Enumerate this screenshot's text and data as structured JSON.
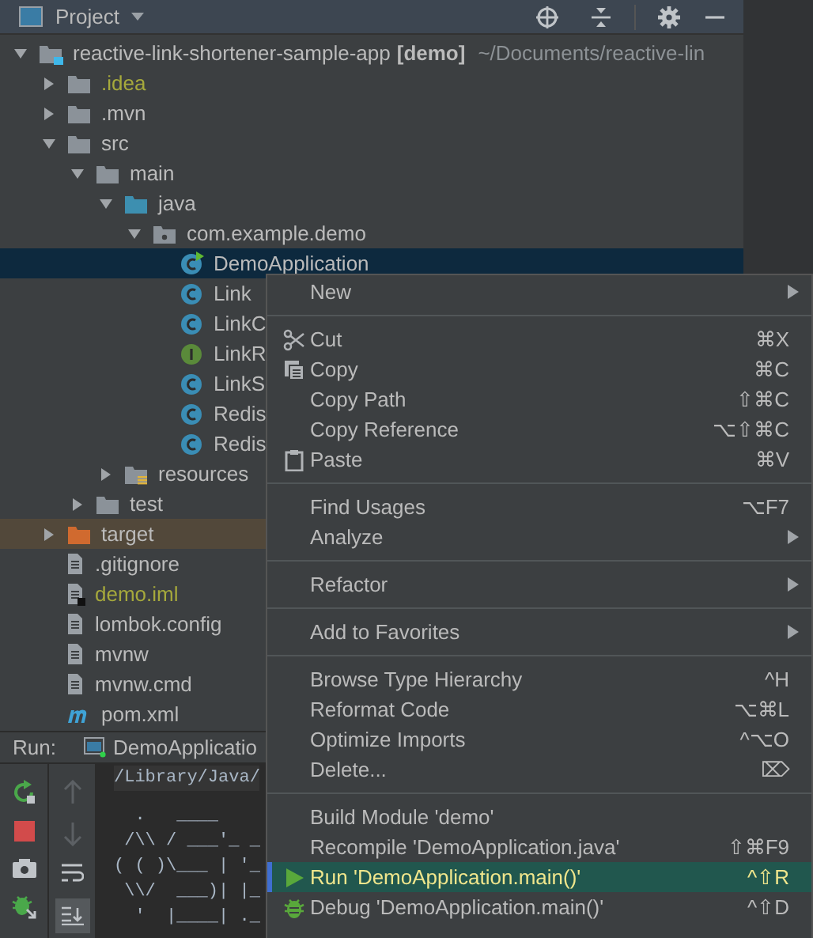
{
  "panel": {
    "title": "Project"
  },
  "tree": [
    {
      "label": "reactive-link-shortener-sample-app",
      "module": "[demo]",
      "path": "~/Documents/reactive-lin",
      "kind": "module",
      "expanded": true,
      "children": [
        {
          "label": ".idea",
          "kind": "folder",
          "expanded": false,
          "color": "#a6a93c"
        },
        {
          "label": ".mvn",
          "kind": "folder",
          "expanded": false
        },
        {
          "label": "src",
          "kind": "folder",
          "expanded": true,
          "children": [
            {
              "label": "main",
              "kind": "folder",
              "expanded": true,
              "children": [
                {
                  "label": "java",
                  "kind": "source",
                  "expanded": true,
                  "children": [
                    {
                      "label": "com.example.demo",
                      "kind": "package",
                      "expanded": true,
                      "children": [
                        {
                          "label": "DemoApplication",
                          "kind": "runclass",
                          "selected": true
                        },
                        {
                          "label": "Link",
                          "kind": "class",
                          "selected": false
                        },
                        {
                          "label": "LinkC",
                          "kind": "class",
                          "selected": false
                        },
                        {
                          "label": "LinkR",
                          "kind": "interface",
                          "selected": false
                        },
                        {
                          "label": "LinkS",
                          "kind": "class",
                          "selected": false
                        },
                        {
                          "label": "Redis",
                          "kind": "class",
                          "selected": false
                        },
                        {
                          "label": "Redis",
                          "kind": "class",
                          "selected": false
                        }
                      ]
                    }
                  ]
                },
                {
                  "label": "resources",
                  "kind": "resources",
                  "expanded": false
                }
              ]
            },
            {
              "label": "test",
              "kind": "folder",
              "expanded": false
            }
          ]
        },
        {
          "label": "target",
          "kind": "excluded",
          "expanded": false,
          "highlighted": true
        },
        {
          "label": ".gitignore",
          "kind": "file"
        },
        {
          "label": "demo.iml",
          "kind": "iml",
          "color": "#a6a93c"
        },
        {
          "label": "lombok.config",
          "kind": "file"
        },
        {
          "label": "mvnw",
          "kind": "file"
        },
        {
          "label": "mvnw.cmd",
          "kind": "file"
        },
        {
          "label": "pom.xml",
          "kind": "maven"
        }
      ]
    }
  ],
  "run": {
    "label": "Run:",
    "tab": "DemoApplicatio",
    "console": [
      "/Library/Java/",
      "  .   ____",
      " /\\\\ / ___'_ _",
      "( ( )\\___ | '_",
      " \\\\/  ___)| |_",
      "  '  |____| ._"
    ]
  },
  "menu": [
    {
      "kind": "item",
      "label": "New",
      "submenu": true
    },
    {
      "kind": "separator"
    },
    {
      "kind": "cut",
      "label": "Cut",
      "shortcut": "⌘X"
    },
    {
      "kind": "copy",
      "label": "Copy",
      "shortcut": "⌘C"
    },
    {
      "kind": "item",
      "label": "Copy Path",
      "shortcut": "⇧⌘C"
    },
    {
      "kind": "item",
      "label": "Copy Reference",
      "shortcut": "⌥⇧⌘C"
    },
    {
      "kind": "paste",
      "label": "Paste",
      "shortcut": "⌘V"
    },
    {
      "kind": "separator"
    },
    {
      "kind": "item",
      "label": "Find Usages",
      "shortcut": "⌥F7"
    },
    {
      "kind": "item",
      "label": "Analyze",
      "submenu": true
    },
    {
      "kind": "separator"
    },
    {
      "kind": "item",
      "label": "Refactor",
      "submenu": true
    },
    {
      "kind": "separator"
    },
    {
      "kind": "item",
      "label": "Add to Favorites",
      "submenu": true
    },
    {
      "kind": "separator"
    },
    {
      "kind": "item",
      "label": "Browse Type Hierarchy",
      "shortcut": "^H"
    },
    {
      "kind": "item",
      "label": "Reformat Code",
      "shortcut": "⌥⌘L"
    },
    {
      "kind": "item",
      "label": "Optimize Imports",
      "shortcut": "^⌥O"
    },
    {
      "kind": "item",
      "label": "Delete...",
      "shortcut": "⌦"
    },
    {
      "kind": "separator"
    },
    {
      "kind": "item",
      "label": "Build Module 'demo'"
    },
    {
      "kind": "item",
      "label": "Recompile 'DemoApplication.java'",
      "shortcut": "⇧⌘F9"
    },
    {
      "kind": "run",
      "label": "Run 'DemoApplication.main()'",
      "shortcut": "^⇧R",
      "selected": true
    },
    {
      "kind": "debug",
      "label": "Debug 'DemoApplication.main()'",
      "shortcut": "^⇧D",
      "selected": false
    }
  ]
}
